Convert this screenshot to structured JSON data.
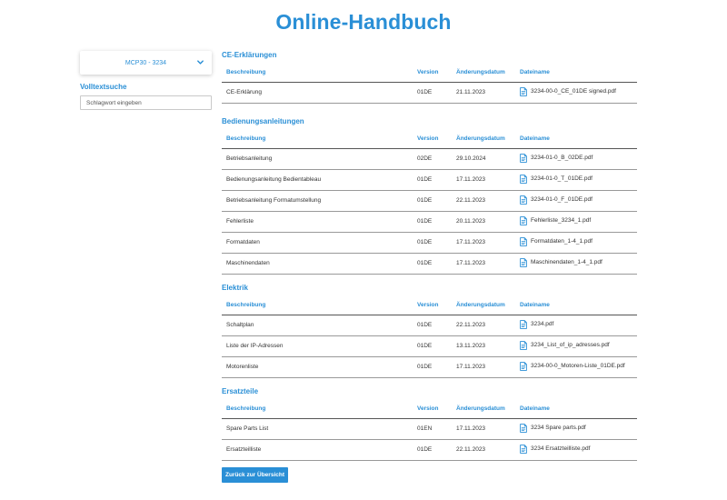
{
  "title": "Online-Handbuch",
  "sidebar": {
    "machine_select": "MCP30 - 3234",
    "fulltext_label": "Volltextsuche",
    "search_placeholder": "Schlagwort eingeben"
  },
  "table_headers": {
    "description": "Beschreibung",
    "version": "Version",
    "date": "Änderungsdatum",
    "filename": "Dateiname"
  },
  "sections": [
    {
      "title": "CE-Erklärungen",
      "rows": [
        {
          "description": "CE-Erklärung",
          "version": "01DE",
          "date": "21.11.2023",
          "file": "3234-00-0_CE_01DE signed.pdf"
        }
      ]
    },
    {
      "title": "Bedienungsanleitungen",
      "rows": [
        {
          "description": "Betriebsanleitung",
          "version": "02DE",
          "date": "29.10.2024",
          "file": "3234-01-0_B_02DE.pdf"
        },
        {
          "description": "Bedienungsanleitung Bedientableau",
          "version": "01DE",
          "date": "17.11.2023",
          "file": "3234-01-0_T_01DE.pdf"
        },
        {
          "description": "Betriebsanleitung Formatumstellung",
          "version": "01DE",
          "date": "22.11.2023",
          "file": "3234-01-0_F_01DE.pdf"
        },
        {
          "description": "Fehlerliste",
          "version": "01DE",
          "date": "20.11.2023",
          "file": "Fehlerliste_3234_1.pdf"
        },
        {
          "description": "Formatdaten",
          "version": "01DE",
          "date": "17.11.2023",
          "file": "Formatdaten_1-4_1.pdf"
        },
        {
          "description": "Maschinendaten",
          "version": "01DE",
          "date": "17.11.2023",
          "file": "Maschinendaten_1-4_1.pdf"
        }
      ]
    },
    {
      "title": "Elektrik",
      "rows": [
        {
          "description": "Schaltplan",
          "version": "01DE",
          "date": "22.11.2023",
          "file": "3234.pdf"
        },
        {
          "description": "Liste der IP-Adressen",
          "version": "01DE",
          "date": "13.11.2023",
          "file": "3234_List_of_ip_adresses.pdf"
        },
        {
          "description": "Motorenliste",
          "version": "01DE",
          "date": "17.11.2023",
          "file": "3234-00-0_Motoren-Liste_01DE.pdf"
        }
      ]
    },
    {
      "title": "Ersatzteile",
      "rows": [
        {
          "description": "Spare Parts List",
          "version": "01EN",
          "date": "17.11.2023",
          "file": "3234 Spare parts.pdf"
        },
        {
          "description": "Ersatzteilliste",
          "version": "01DE",
          "date": "22.11.2023",
          "file": "3234 Ersatzteilliste.pdf"
        }
      ]
    }
  ],
  "back_button": "Zurück zur Übersicht",
  "icons": {
    "select": "chevron-down-icon",
    "file": "pdf-file-icon"
  },
  "colors": {
    "accent": "#2a8fd6",
    "text": "#333333"
  }
}
